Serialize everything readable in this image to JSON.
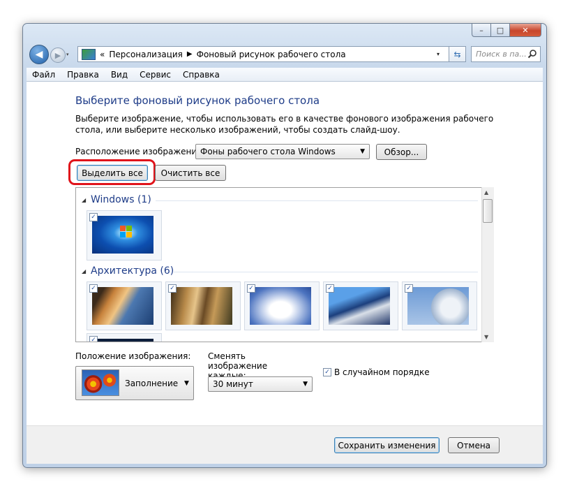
{
  "caption": {
    "minimize": "–",
    "maximize": "□",
    "close": "✕"
  },
  "nav": {
    "back_glyph": "◀",
    "forward_glyph": "▶",
    "dropdown_glyph": "▾",
    "refresh_glyph": "⇆"
  },
  "address": {
    "prefix": "«",
    "crumbs": [
      "Персонализация",
      "Фоновый рисунок рабочего стола"
    ],
    "separator": "▶"
  },
  "search": {
    "placeholder": "Поиск в па..."
  },
  "menu": [
    "Файл",
    "Правка",
    "Вид",
    "Сервис",
    "Справка"
  ],
  "page": {
    "title": "Выберите фоновый рисунок рабочего стола",
    "description": "Выберите изображение, чтобы использовать его в качестве фонового изображения рабочего стола, или выберите несколько изображений, чтобы создать слайд-шоу.",
    "location_label": "Расположение изображения:",
    "location_value": "Фоны рабочего стола Windows",
    "browse": "Обзор...",
    "select_all": "Выделить все",
    "clear_all": "Очистить все"
  },
  "gallery": {
    "groups": [
      {
        "title": "Windows (1)",
        "items": 1
      },
      {
        "title": "Архитектура (6)",
        "items": 6
      }
    ],
    "check_glyph": "✓"
  },
  "options": {
    "position_label": "Положение изображения:",
    "position_value": "Заполнение",
    "change_label": "Сменять изображение каждые:",
    "interval_value": "30 минут",
    "shuffle_label": "В случайном порядке",
    "shuffle_checked": true
  },
  "footer": {
    "save": "Сохранить изменения",
    "cancel": "Отмена"
  },
  "colors": {
    "accent": "#1e3c88",
    "highlight": "#e0141b"
  }
}
